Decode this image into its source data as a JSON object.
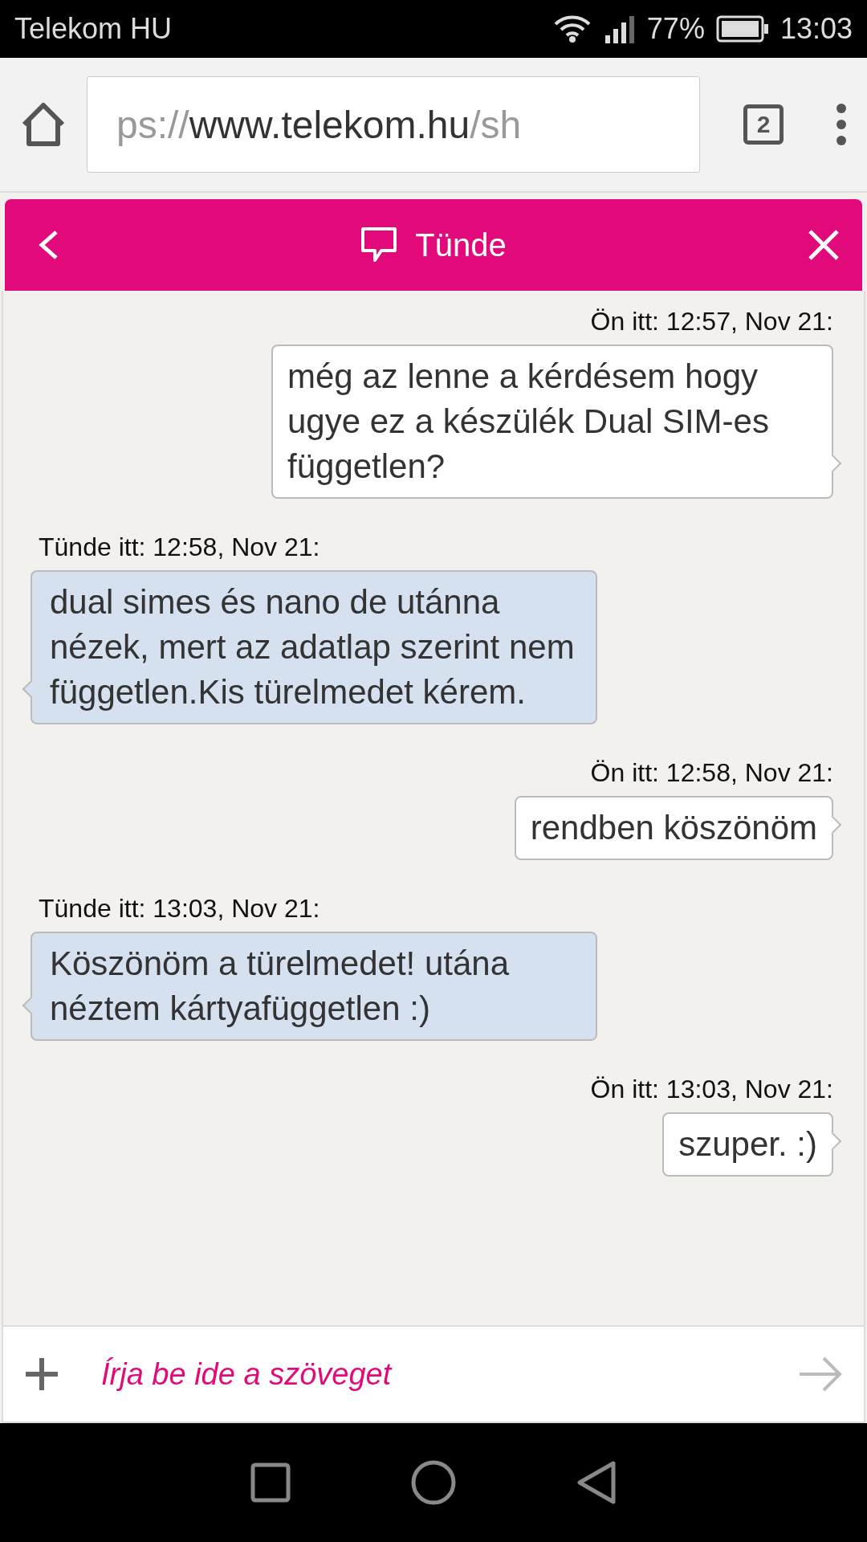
{
  "status_bar": {
    "carrier": "Telekom HU",
    "battery": "77%",
    "time": "13:03"
  },
  "browser": {
    "url_prefix": "ps://",
    "url_host": "www.telekom.hu",
    "url_suffix": "/sh",
    "tab_count": "2"
  },
  "chat_header": {
    "title": "Tünde"
  },
  "messages": [
    {
      "kind": "sent",
      "timestamp": "Ön itt: 12:57, Nov 21:",
      "text": " még az lenne a kérdésem hogy ugye ez a készülék Dual SIM-es független?"
    },
    {
      "kind": "received",
      "timestamp": "Tünde itt: 12:58, Nov 21:",
      "text": "dual simes és nano de utánna nézek, mert az adatlap szerint nem független.Kis türelmedet kérem."
    },
    {
      "kind": "sent",
      "timestamp": "Ön itt: 12:58, Nov 21:",
      "text": "rendben köszönöm"
    },
    {
      "kind": "received",
      "timestamp": "Tünde itt: 13:03, Nov 21:",
      "text": "Köszönöm a türelmedet! utána néztem kártyafüggetlen :)"
    },
    {
      "kind": "sent",
      "timestamp": "Ön itt: 13:03, Nov 21:",
      "text": "szuper. :)"
    }
  ],
  "composer": {
    "placeholder": "Írja be ide a szöveget"
  }
}
